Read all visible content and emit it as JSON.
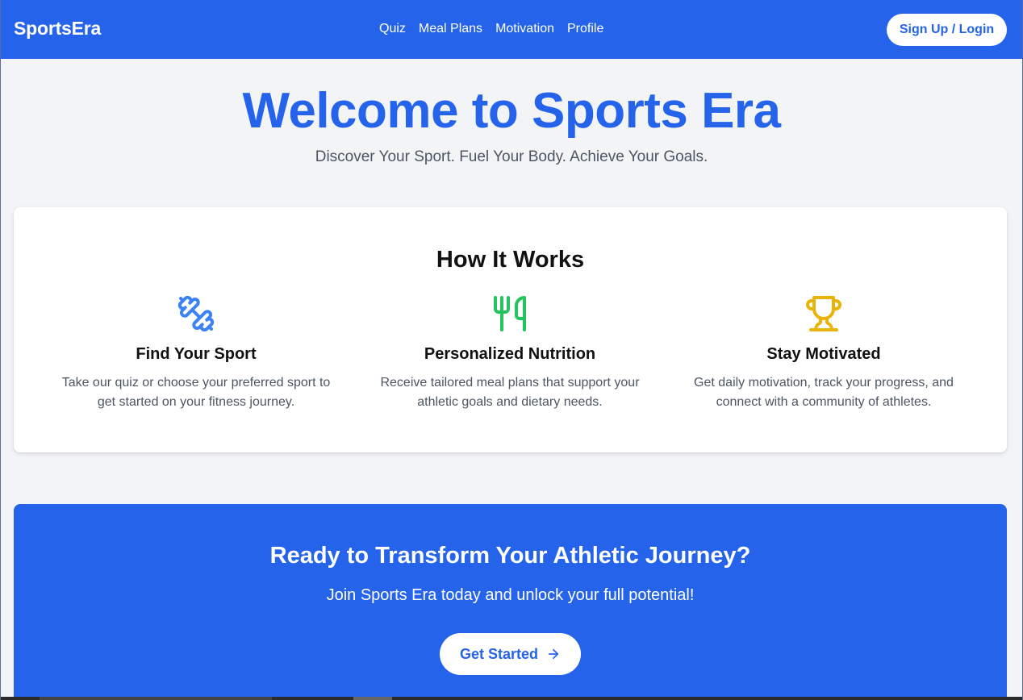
{
  "navbar": {
    "brand": "SportsEra",
    "links": [
      "Quiz",
      "Meal Plans",
      "Motivation",
      "Profile"
    ],
    "signup_label": "Sign Up / Login",
    "background": "#2563eb"
  },
  "hero": {
    "title": "Welcome to Sports Era",
    "subtitle": "Discover Your Sport. Fuel Your Body. Achieve Your Goals."
  },
  "how_it_works": {
    "title": "How It Works",
    "features": [
      {
        "icon": "dumbbell-icon",
        "icon_color": "#3b82f6",
        "title": "Find Your Sport",
        "description": "Take our quiz or choose your preferred sport to get started on your fitness journey."
      },
      {
        "icon": "utensils-icon",
        "icon_color": "#22c55e",
        "title": "Personalized Nutrition",
        "description": "Receive tailored meal plans that support your athletic goals and dietary needs."
      },
      {
        "icon": "trophy-icon",
        "icon_color": "#eab308",
        "title": "Stay Motivated",
        "description": "Get daily motivation, track your progress, and connect with a community of athletes."
      }
    ]
  },
  "cta": {
    "title": "Ready to Transform Your Athletic Journey?",
    "subtitle": "Join Sports Era today and unlock your full potential!",
    "button_label": "Get Started",
    "button_icon": "arrow-right-icon"
  }
}
